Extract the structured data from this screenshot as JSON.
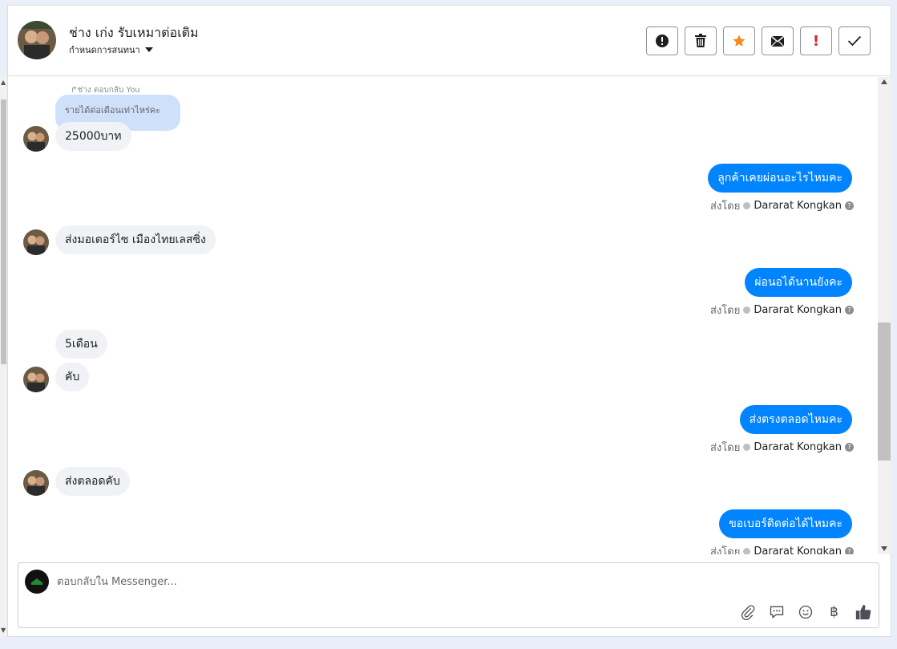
{
  "header": {
    "name": "ช่าง เก่ง รับเหมาต่อเติม",
    "subtitle": "กำหนดการสนทนา",
    "actions": [
      {
        "icon": "alert-circle-icon",
        "label": "report"
      },
      {
        "icon": "trash-icon",
        "label": "delete"
      },
      {
        "icon": "star-icon",
        "label": "star"
      },
      {
        "icon": "mark-unread-icon",
        "label": "unread"
      },
      {
        "icon": "exclamation-icon",
        "label": "important"
      },
      {
        "icon": "check-icon",
        "label": "done"
      }
    ]
  },
  "conversation": {
    "reply_label": "ช่าง ตอบกลับ You",
    "quoted_text": "รายได้ต่อเดือนเท่าไหร่คะ",
    "sent_by_prefix": "ส่งโดย",
    "agent_name": "Dararat Kongkan",
    "messages": [
      {
        "dir": "in",
        "text": "25000บาท"
      },
      {
        "dir": "out",
        "text": "ลูกค้าเคยผ่อนอะไรไหมคะ"
      },
      {
        "dir": "in",
        "text": "ส่งมอเตอร์ไซ  เมืองไทยเลสซิ่ง"
      },
      {
        "dir": "out",
        "text": "ผ่อนอได้นานยังคะ"
      },
      {
        "dir": "in",
        "text": "5เดือน"
      },
      {
        "dir": "in",
        "text": "คับ"
      },
      {
        "dir": "out",
        "text": "ส่งตรงตลอดไหมคะ"
      },
      {
        "dir": "in",
        "text": "ส่งตลอดคับ"
      },
      {
        "dir": "out",
        "text": "ขอเบอร์ติดต่อได้ไหมคะ"
      }
    ]
  },
  "composer": {
    "placeholder": "ตอบกลับใน Messenger...",
    "tools": [
      "attach-icon",
      "comment-icon",
      "emoji-icon",
      "baht-icon",
      "like-icon"
    ],
    "baht_symbol": "฿"
  },
  "colors": {
    "outgoing_bubble": "#0084ff",
    "incoming_bubble": "#f0f2f5",
    "quoted_bubble": "#cfe0fb",
    "star": "#f38b21",
    "important": "#e02020"
  }
}
